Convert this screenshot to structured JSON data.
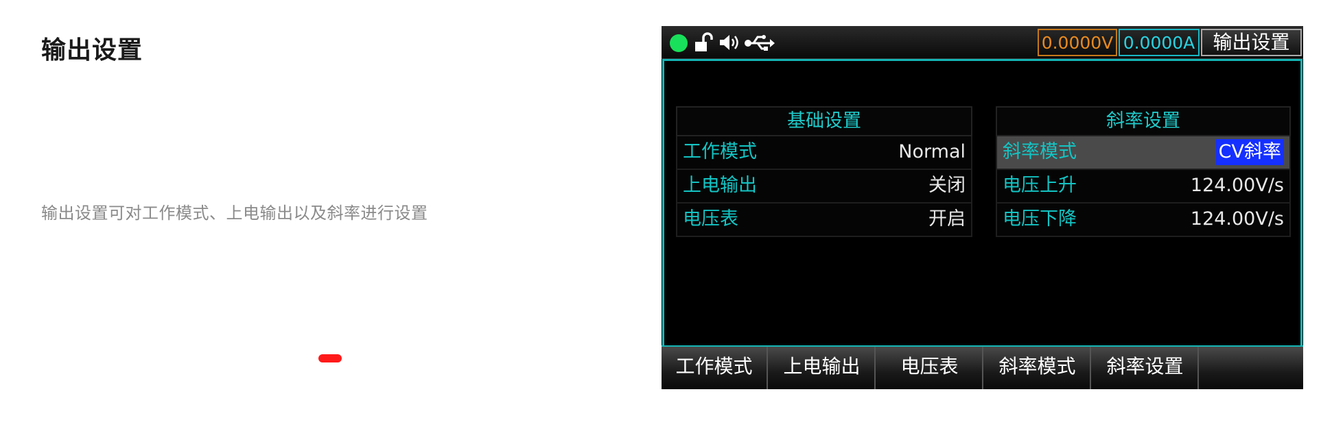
{
  "page": {
    "title": "输出设置",
    "description": "输出设置可对工作模式、上电输出以及斜率进行设置"
  },
  "device": {
    "status": {
      "indicator_color": "#19e05a",
      "icons": [
        "unlock-icon",
        "speaker-icon",
        "usb-icon"
      ],
      "voltage_readout": "0.0000V",
      "current_readout": "0.0000A",
      "screen_title": "输出设置"
    },
    "basic_settings": {
      "heading": "基础设置",
      "rows": [
        {
          "label": "工作模式",
          "value": "Normal"
        },
        {
          "label": "上电输出",
          "value": "关闭"
        },
        {
          "label": "电压表",
          "value": "开启"
        }
      ]
    },
    "slope_settings": {
      "heading": "斜率设置",
      "rows": [
        {
          "label": "斜率模式",
          "value": "CV斜率"
        },
        {
          "label": "电压上升",
          "value": "124.00V/s"
        },
        {
          "label": "电压下降",
          "value": "124.00V/s"
        }
      ]
    },
    "softkeys": [
      "工作模式",
      "上电输出",
      "电压表",
      "斜率模式",
      "斜率设置",
      ""
    ],
    "colors": {
      "accent": "#14b5b5",
      "label_text": "#13c4c4",
      "voltage": "#e88a20",
      "current": "#29d2e0",
      "highlight": "#1530ff",
      "marker": "#ff1a1a"
    }
  }
}
